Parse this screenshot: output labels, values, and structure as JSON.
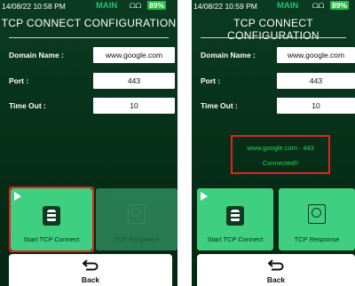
{
  "left": {
    "status": {
      "time": "14/08/22 10:58 PM",
      "mode": "MAIN",
      "signal": "ᗝᗝ",
      "battery": "89%"
    },
    "title": "TCP CONNECT CONFIGURATION",
    "fields": [
      {
        "label": "Domain Name :",
        "value": "www.google.com"
      },
      {
        "label": "Port :",
        "value": "443"
      },
      {
        "label": "Time Out :",
        "value": "10"
      }
    ],
    "tiles": {
      "start_label": "Start TCP Connect",
      "response_label": "TCP Response"
    },
    "back_label": "Back"
  },
  "right": {
    "status": {
      "time": "14/08/22 10:59 PM",
      "mode": "MAIN",
      "signal": "ᗝᗝ",
      "battery": "89%"
    },
    "title": "TCP CONNECT CONFIGURATION",
    "fields": [
      {
        "label": "Domain Name :",
        "value": "www.google.com"
      },
      {
        "label": "Port :",
        "value": "443"
      },
      {
        "label": "Time Out :",
        "value": "10"
      }
    ],
    "connection": {
      "address": "www.google.com : 443",
      "status": "Connected!!"
    },
    "tiles": {
      "start_label": "Start TCP Connect",
      "response_label": "TCP Response"
    },
    "back_label": "Back"
  },
  "colors": {
    "accent_green": "#3ecf80",
    "highlight_red": "#e02424",
    "status_green": "#2fcf58"
  }
}
